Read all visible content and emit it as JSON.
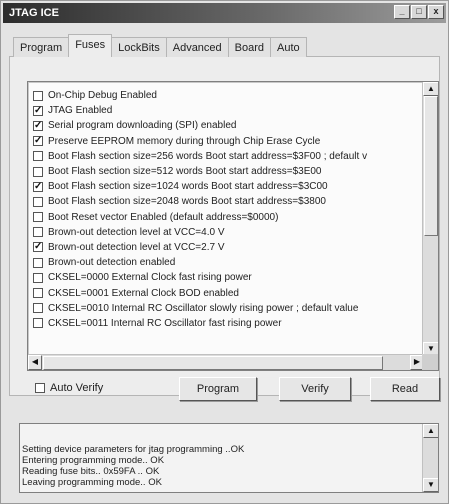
{
  "window": {
    "title": "JTAG ICE",
    "minimize_glyph": "_",
    "restore_glyph": "□",
    "close_glyph": "x"
  },
  "tabs": [
    {
      "label": "Program",
      "active": false
    },
    {
      "label": "Fuses",
      "active": true
    },
    {
      "label": "LockBits",
      "active": false
    },
    {
      "label": "Advanced",
      "active": false
    },
    {
      "label": "Board",
      "active": false
    },
    {
      "label": "Auto",
      "active": false
    }
  ],
  "fuses": [
    {
      "label": "On-Chip Debug Enabled",
      "checked": false
    },
    {
      "label": "JTAG Enabled",
      "checked": true
    },
    {
      "label": "Serial program downloading (SPI) enabled",
      "checked": true
    },
    {
      "label": "Preserve EEPROM memory during through Chip Erase Cycle",
      "checked": true
    },
    {
      "label": "Boot Flash section size=256 words Boot start address=$3F00 ; default v",
      "checked": false
    },
    {
      "label": "Boot Flash section size=512 words Boot start address=$3E00",
      "checked": false
    },
    {
      "label": "Boot Flash section size=1024 words Boot start address=$3C00",
      "checked": true
    },
    {
      "label": "Boot Flash section size=2048 words Boot start address=$3800",
      "checked": false
    },
    {
      "label": "Boot Reset vector Enabled (default address=$0000)",
      "checked": false
    },
    {
      "label": "Brown-out detection level at VCC=4.0 V",
      "checked": false
    },
    {
      "label": "Brown-out detection level at VCC=2.7 V",
      "checked": true
    },
    {
      "label": "Brown-out detection enabled",
      "checked": false
    },
    {
      "label": "CKSEL=0000 External Clock fast rising power",
      "checked": false
    },
    {
      "label": "CKSEL=0001 External Clock BOD enabled",
      "checked": false
    },
    {
      "label": "CKSEL=0010 Internal RC Oscillator slowly rising power ; default value",
      "checked": false
    },
    {
      "label": "CKSEL=0011 Internal RC Oscillator fast rising power",
      "checked": false
    }
  ],
  "controls": {
    "auto_verify_label": "Auto Verify",
    "auto_verify_checked": false,
    "program_label": "Program",
    "verify_label": "Verify",
    "read_label": "Read"
  },
  "log": [
    "Setting device parameters for jtag programming ..OK",
    "Entering programming mode.. OK",
    "Reading fuse bits.. 0x59FA .. OK",
    "Leaving programming mode.. OK"
  ]
}
